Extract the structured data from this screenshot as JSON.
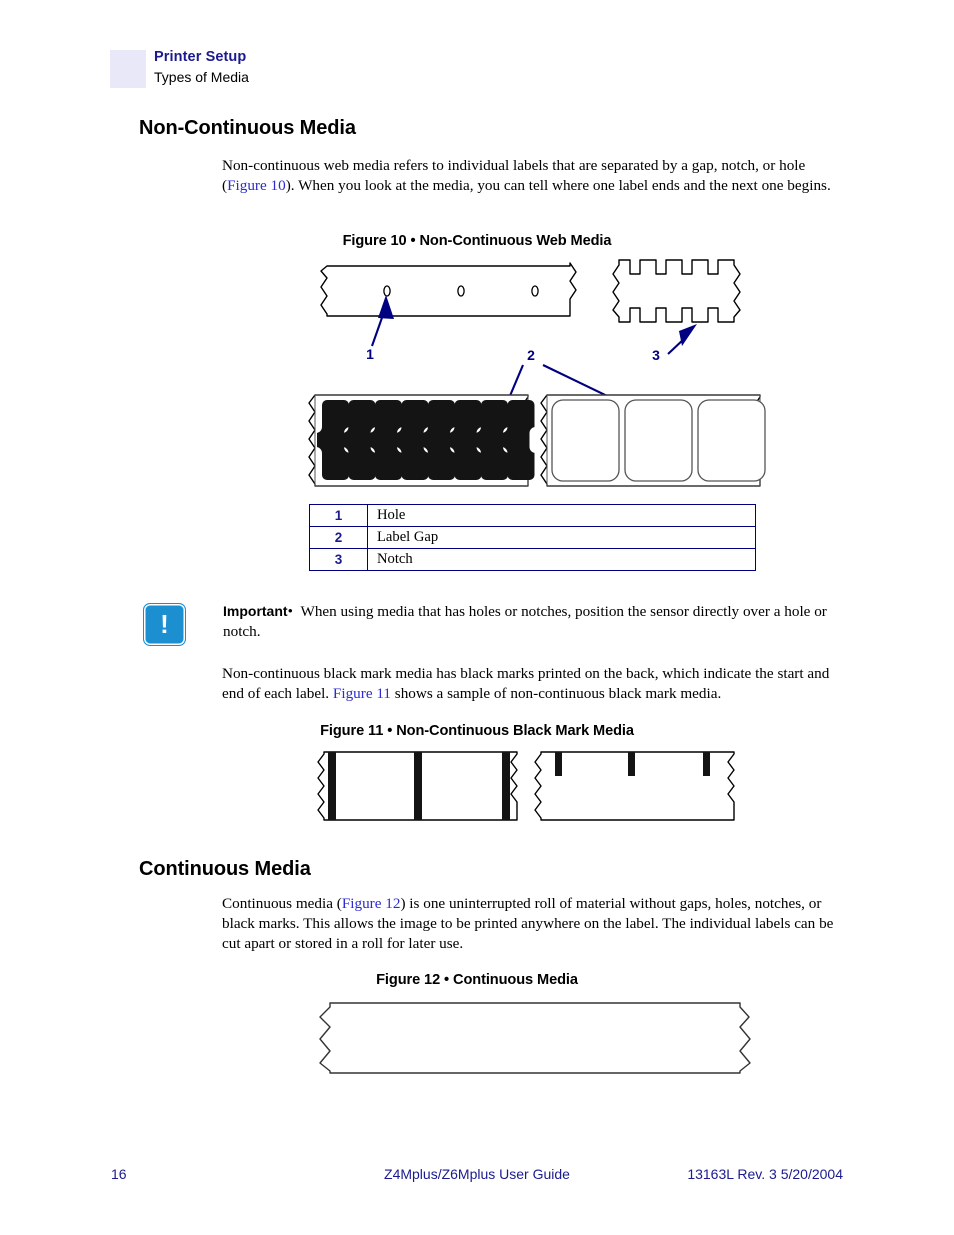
{
  "header": {
    "chapter": "Printer Setup",
    "section": "Types of Media",
    "accent_color": "#1b1b8f",
    "block_color": "#e8e8f8"
  },
  "sections": {
    "non_continuous": {
      "heading": "Non-Continuous Media",
      "paragraph_1a": "Non-continuous web media refers to individual labels that are separated by a gap, notch, or hole (",
      "paragraph_1_xref": "Figure 10",
      "paragraph_1b": "). When you look at the media, you can tell where one label ends and the next one begins.",
      "paragraph_2a": "Non-continuous black mark media has black marks printed on the back, which indicate the start and end of each label. ",
      "paragraph_2_xref": "Figure 11",
      "paragraph_2b": " shows a sample of non-continuous black mark media."
    },
    "continuous": {
      "heading": "Continuous Media",
      "paragraph_1a": "Continuous media (",
      "paragraph_1_xref": "Figure 12",
      "paragraph_1b": ") is one uninterrupted roll of material without gaps, holes, notches, or black marks. This allows the image to be printed anywhere on the label. The individual labels can be cut apart or stored in a roll for later use."
    }
  },
  "figures": {
    "fig10": {
      "caption": "Figure 10 • Non-Continuous Web Media",
      "callouts": [
        "1",
        "2",
        "3"
      ],
      "callout_color": "#000080",
      "hole_count": 3,
      "notch_count": 4,
      "black_label_count": 8,
      "white_label_count": 3
    },
    "fig11": {
      "caption": "Figure 11 • Non-Continuous Black Mark Media",
      "left_mark_count": 3,
      "right_mark_count": 3
    },
    "fig12": {
      "caption": "Figure 12 • Continuous Media"
    }
  },
  "legend": {
    "rows": [
      {
        "num": "1",
        "label": "Hole"
      },
      {
        "num": "2",
        "label": "Label Gap"
      },
      {
        "num": "3",
        "label": "Notch"
      }
    ],
    "border_color": "#000080"
  },
  "important": {
    "icon": "exclamation-icon",
    "label": "Important",
    "bullet": "•",
    "text": "When using media that has holes or notches, position the sensor directly over a hole or notch.",
    "icon_color": "#1b8fd0"
  },
  "footer": {
    "page_number": "16",
    "guide_title": "Z4Mplus/Z6Mplus User Guide",
    "revision": "13163L Rev. 3   5/20/2004",
    "color": "#1b1b8f"
  }
}
